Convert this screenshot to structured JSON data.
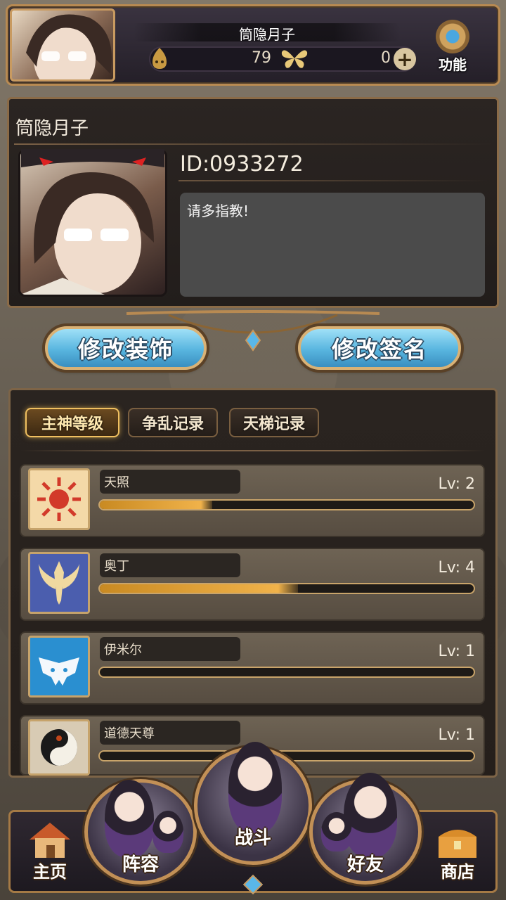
{
  "header": {
    "player_name": "筒隐月子",
    "resource_1_icon": "flame-spirit-icon",
    "resource_1_value": "79",
    "resource_2_icon": "butterfly-icon",
    "resource_2_value": "0",
    "add_icon": "plus-icon",
    "func_label": "功能",
    "func_icon": "gear-icon"
  },
  "profile": {
    "name": "筒隐月子",
    "id": "ID:0933272",
    "signature": "请多指教!"
  },
  "buttons": {
    "edit_decoration": "修改装饰",
    "edit_signature": "修改签名"
  },
  "tabs": [
    {
      "label": "主神等级",
      "active": true
    },
    {
      "label": "争乱记录",
      "active": false
    },
    {
      "label": "天梯记录",
      "active": false
    }
  ],
  "gods": [
    {
      "name": "天照",
      "level": "Lv: 2",
      "progress": 0.3,
      "icon": "sun-icon",
      "color": "#f4d9a8"
    },
    {
      "name": "奥丁",
      "level": "Lv: 4",
      "progress": 0.53,
      "icon": "wing-sword-icon",
      "color": "#4b5eae"
    },
    {
      "name": "伊米尔",
      "level": "Lv: 1",
      "progress": 0.0,
      "icon": "ice-beast-icon",
      "color": "#2a8fd0"
    },
    {
      "name": "道德天尊",
      "level": "Lv: 1",
      "progress": 0.0,
      "icon": "yin-yang-icon",
      "color": "#d8cbb4"
    }
  ],
  "nav": {
    "home": "主页",
    "lineup": "阵容",
    "battle": "战斗",
    "friends": "好友",
    "shop": "商店"
  }
}
